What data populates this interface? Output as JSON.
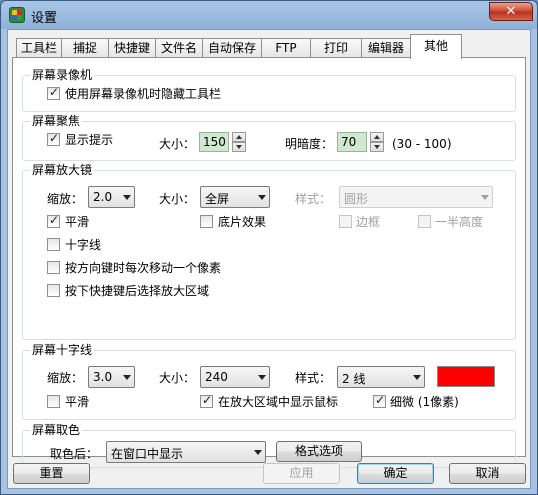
{
  "window": {
    "title": "设置",
    "close_label": "✕"
  },
  "tabs": [
    {
      "label": "工具栏"
    },
    {
      "label": "捕捉"
    },
    {
      "label": "快捷键"
    },
    {
      "label": "文件名"
    },
    {
      "label": "自动保存"
    },
    {
      "label": "FTP"
    },
    {
      "label": "打印"
    },
    {
      "label": "编辑器"
    },
    {
      "label": "其他"
    }
  ],
  "screen_recorder": {
    "title": "屏幕录像机",
    "hide_toolbar_label": "使用屏幕录像机时隐藏工具栏",
    "hide_toolbar_checked": true
  },
  "spotlight": {
    "title": "屏幕聚焦",
    "show_hint_label": "显示提示",
    "show_hint_checked": true,
    "size_label": "大小：",
    "size_value": "150",
    "brightness_label": "明暗度：",
    "brightness_value": "70",
    "brightness_range": "(30 - 100)"
  },
  "magnifier": {
    "title": "屏幕放大镜",
    "zoom_label": "缩放：",
    "zoom_value": "2.0",
    "size_label": "大小：",
    "size_value": "全屏",
    "style_label": "样式：",
    "style_value": "圆形",
    "smooth_label": "平滑",
    "smooth_checked": true,
    "film_label": "底片效果",
    "film_checked": false,
    "border_label": "边框",
    "half_height_label": "一半高度",
    "crosshair_label": "十字线",
    "crosshair_checked": false,
    "arrow_move_label": "按方向键时每次移动一个像素",
    "arrow_move_checked": false,
    "hotkey_select_label": "按下快捷键后选择放大区域",
    "hotkey_select_checked": false
  },
  "crosshair": {
    "title": "屏幕十字线",
    "zoom_label": "缩放：",
    "zoom_value": "3.0",
    "size_label": "大小：",
    "size_value": "240",
    "style_label": "样式：",
    "style_value": "2 线",
    "color": "#ff0000",
    "smooth_label": "平滑",
    "smooth_checked": false,
    "show_cursor_label": "在放大区域中显示鼠标",
    "show_cursor_checked": true,
    "thin_label": "细微 (1像素)",
    "thin_checked": true
  },
  "color_picker": {
    "title": "屏幕取色",
    "after_label": "取色后：",
    "after_value": "在窗口中显示",
    "format_button": "格式选项"
  },
  "footer": {
    "reset": "重置",
    "apply": "应用",
    "ok": "确定",
    "cancel": "取消"
  }
}
